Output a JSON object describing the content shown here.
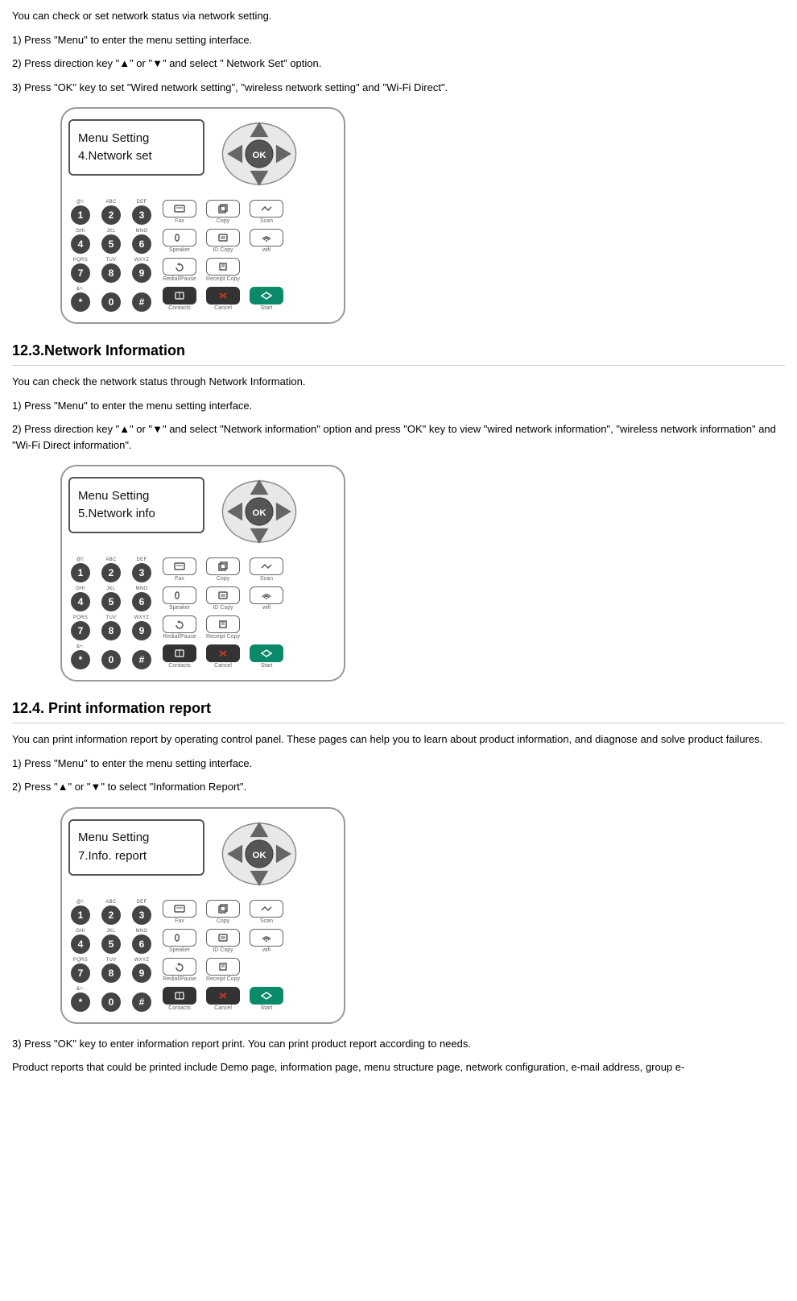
{
  "section1": {
    "intro": "You can check or set network status via network setting.",
    "step1": "1) Press \"Menu\" to enter the menu setting interface.",
    "step2": "2) Press direction key \"▲\" or \"▼\" and select \" Network Set\" option.",
    "step3": "3) Press \"OK\" key to set \"Wired network setting\", \"wireless network setting\" and \"Wi-Fi Direct\".",
    "lcd_line1": "Menu Setting",
    "lcd_line2": "4.Network set"
  },
  "section2": {
    "heading": "12.3.Network Information",
    "intro": "You can check the network status through Network Information.",
    "step1": "1) Press \"Menu\" to enter the menu setting interface.",
    "step2": "2) Press direction key \"▲\" or \"▼\" and select \"Network information\" option and press \"OK\" key to view \"wired network information\", \"wireless network information\" and \"Wi-Fi Direct information\".",
    "lcd_line1": "Menu Setting",
    "lcd_line2": "5.Network info"
  },
  "section3": {
    "heading": "12.4. Print information report",
    "intro": "You can print information report by operating control panel. These pages can help you to learn about product information, and diagnose and solve product failures.",
    "step1": "1) Press \"Menu\" to enter the menu setting interface.",
    "step2": "2) Press \"▲\" or \"▼\" to select \"Information Report\".",
    "lcd_line1": "Menu Setting",
    "lcd_line2": "7.Info. report",
    "step3": "3) Press \"OK\" key to enter information report print. You can print product report according to needs.",
    "footer": "Product reports that could be printed include Demo page, information page, menu structure page, network configuration, e-mail address, group e-"
  },
  "keypad": {
    "labels": [
      "@!:",
      "ABC",
      "DEF",
      "GHI",
      "JKL",
      "MNO",
      "PQRS",
      "TUV",
      "WXYZ",
      "&+.",
      "",
      ""
    ],
    "keys": [
      "1",
      "2",
      "3",
      "4",
      "5",
      "6",
      "7",
      "8",
      "9",
      "*",
      "0",
      "#"
    ]
  },
  "func": {
    "row1": [
      "Fax",
      "Copy",
      "Scan"
    ],
    "row2": [
      "Speaker",
      "ID Copy",
      "wifi"
    ],
    "row3": [
      "Redial/Pause",
      "Receipt Copy",
      ""
    ],
    "row4": [
      "Contacts",
      "Cancel",
      "Start"
    ]
  },
  "ok_label": "OK"
}
